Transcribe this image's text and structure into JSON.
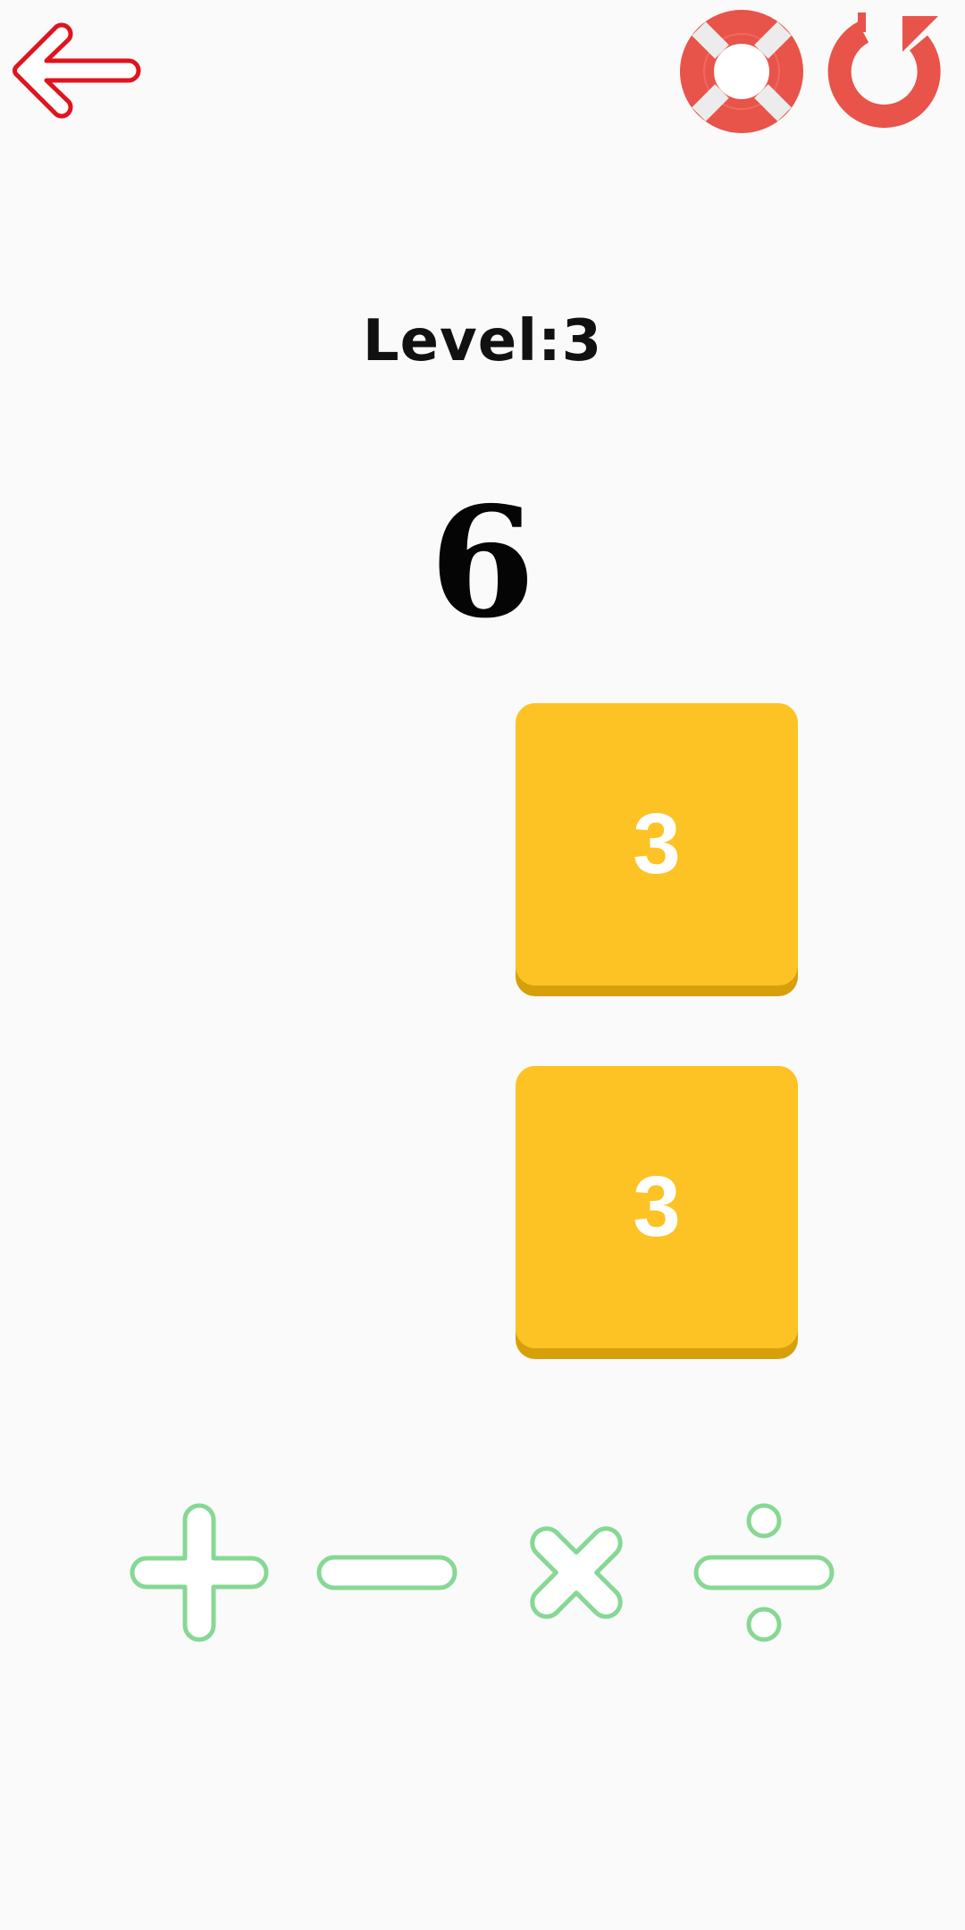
{
  "header": {
    "back_icon": "back-arrow-icon",
    "help_icon": "lifebuoy-icon",
    "restart_icon": "restart-icon"
  },
  "game": {
    "level_text": "Level:3",
    "target": "6",
    "tiles": [
      {
        "value": "3"
      },
      {
        "value": "3"
      }
    ]
  },
  "operators": [
    {
      "name": "plus",
      "icon": "plus-icon"
    },
    {
      "name": "minus",
      "icon": "minus-icon"
    },
    {
      "name": "multiply",
      "icon": "multiply-icon"
    },
    {
      "name": "divide",
      "icon": "divide-icon"
    }
  ],
  "colors": {
    "background": "#fafafa",
    "accent_red": "#e8534a",
    "back_arrow": "#e0141e",
    "tile": "#fdc324",
    "tile_shadow": "#d7a00a",
    "operator_green": "#86d894"
  }
}
